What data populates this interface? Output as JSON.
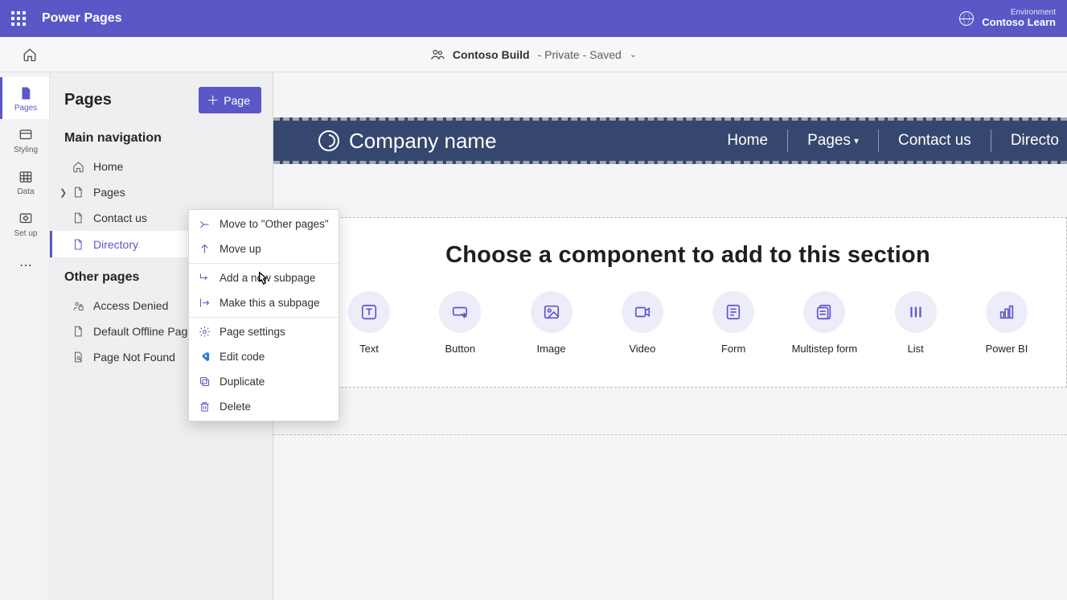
{
  "topbar": {
    "app_title": "Power Pages",
    "env_label": "Environment",
    "env_name": "Contoso Learn"
  },
  "subbar": {
    "site_name": "Contoso Build",
    "site_status": "- Private - Saved"
  },
  "rail": {
    "items": [
      {
        "label": "Pages"
      },
      {
        "label": "Styling"
      },
      {
        "label": "Data"
      },
      {
        "label": "Set up"
      }
    ]
  },
  "sidebar": {
    "title": "Pages",
    "add_button": "Page",
    "section_main": "Main navigation",
    "section_other": "Other pages",
    "main_items": [
      {
        "label": "Home"
      },
      {
        "label": "Pages"
      },
      {
        "label": "Contact us"
      },
      {
        "label": "Directory"
      }
    ],
    "other_items": [
      {
        "label": "Access Denied"
      },
      {
        "label": "Default Offline Page"
      },
      {
        "label": "Page Not Found"
      }
    ]
  },
  "preview": {
    "company": "Company name",
    "links": [
      {
        "label": "Home"
      },
      {
        "label": "Pages"
      },
      {
        "label": "Contact us"
      },
      {
        "label": "Directo"
      }
    ]
  },
  "section": {
    "title": "Choose a component to add to this section",
    "components": [
      {
        "label": "Text"
      },
      {
        "label": "Button"
      },
      {
        "label": "Image"
      },
      {
        "label": "Video"
      },
      {
        "label": "Form"
      },
      {
        "label": "Multistep form"
      },
      {
        "label": "List"
      },
      {
        "label": "Power BI"
      }
    ]
  },
  "context_menu": {
    "items": [
      {
        "label": "Move to \"Other pages\""
      },
      {
        "label": "Move up"
      },
      {
        "label": "Add a new subpage"
      },
      {
        "label": "Make this a subpage"
      },
      {
        "label": "Page settings"
      },
      {
        "label": "Edit code"
      },
      {
        "label": "Duplicate"
      },
      {
        "label": "Delete"
      }
    ]
  }
}
